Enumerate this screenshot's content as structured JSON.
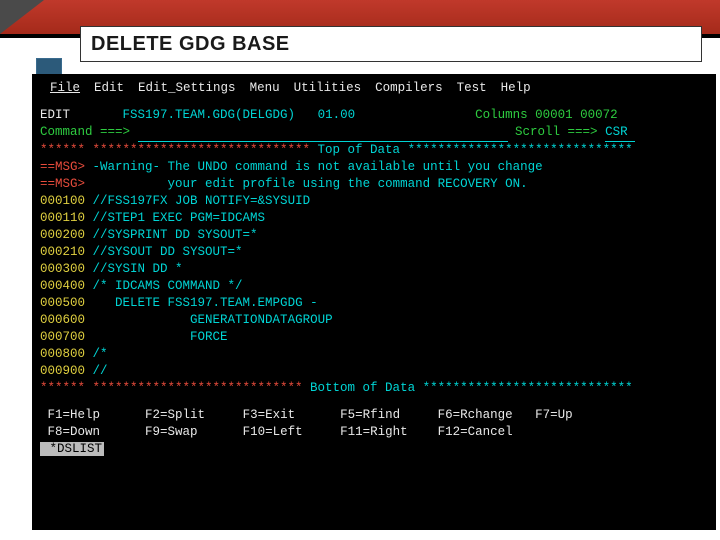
{
  "slide": {
    "title": "DELETE GDG BASE"
  },
  "menu": {
    "items": [
      "File",
      "Edit",
      "Edit_Settings",
      "Menu",
      "Utilities",
      "Compilers",
      "Test",
      "Help"
    ]
  },
  "editor": {
    "mode": "EDIT",
    "dataset": "FSS197.TEAM.GDG(DELGDG)",
    "member_ver": "01.00",
    "columns_label": "Columns 00001 00072",
    "command_prompt": "Command ===>",
    "command_value": "",
    "scroll_label": "Scroll ===>",
    "scroll_value": "CSR"
  },
  "banner": {
    "top_left": "****** *****************************",
    "top_mid": " Top of Data ",
    "top_right": "******************************",
    "bot_left": "****** ****************************",
    "bot_mid": " Bottom of Data ",
    "bot_right": "****************************"
  },
  "msgs": [
    {
      "tag": "==MSG>",
      "text": "-Warning- The UNDO command is not available until you change"
    },
    {
      "tag": "==MSG>",
      "text": "          your edit profile using the command RECOVERY ON."
    }
  ],
  "lines": [
    {
      "num": "000100",
      "text": "//FSS197FX JOB NOTIFY=&SYSUID"
    },
    {
      "num": "000110",
      "text": "//STEP1 EXEC PGM=IDCAMS"
    },
    {
      "num": "000200",
      "text": "//SYSPRINT DD SYSOUT=*"
    },
    {
      "num": "000210",
      "text": "//SYSOUT DD SYSOUT=*"
    },
    {
      "num": "000300",
      "text": "//SYSIN DD *"
    },
    {
      "num": "000400",
      "text": "/* IDCAMS COMMAND */"
    },
    {
      "num": "000500",
      "text": "   DELETE FSS197.TEAM.EMPGDG -"
    },
    {
      "num": "000600",
      "text": "             GENERATIONDATAGROUP"
    },
    {
      "num": "000700",
      "text": "             FORCE"
    },
    {
      "num": "000800",
      "text": "/*"
    },
    {
      "num": "000900",
      "text": "//"
    }
  ],
  "pf": {
    "row1": [
      {
        "k": "F1=Help"
      },
      {
        "k": "F2=Split"
      },
      {
        "k": "F3=Exit"
      },
      {
        "k": "F5=Rfind"
      },
      {
        "k": "F6=Rchange"
      },
      {
        "k": "F7=Up"
      }
    ],
    "row2": [
      {
        "k": "F8=Down"
      },
      {
        "k": "F9=Swap"
      },
      {
        "k": "F10=Left"
      },
      {
        "k": "F11=Right"
      },
      {
        "k": "F12=Cancel"
      }
    ],
    "status": " *DSLIST"
  }
}
